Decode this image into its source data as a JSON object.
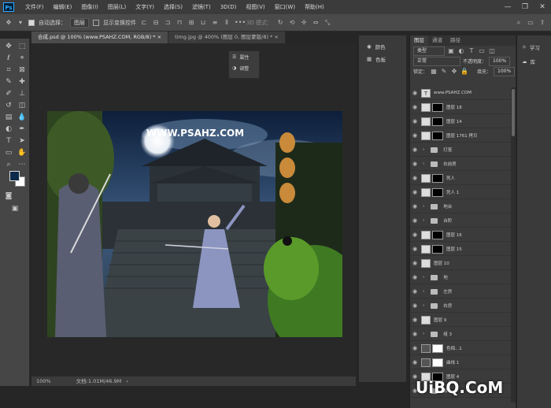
{
  "menu": {
    "items": [
      "文件(F)",
      "编辑(E)",
      "图像(I)",
      "图层(L)",
      "文字(Y)",
      "选择(S)",
      "滤镜(T)",
      "3D(D)",
      "视图(V)",
      "窗口(W)",
      "帮助(H)"
    ],
    "logo": "Ps"
  },
  "options": {
    "auto_select_label": "自动选择：",
    "auto_select_value": "图层",
    "show_transform_label": "显示变换控件",
    "mode3d_label": "3D 模式："
  },
  "tabs": [
    "合成.psd @ 100% (www.PSAHZ.COM, RGB/8) *",
    "timg.jpg @ 400% (图层 0, 图层蒙版/8) *"
  ],
  "canvas": {
    "headline": "WWW.PSAHZ.COM"
  },
  "status": {
    "zoom": "100%",
    "doc": "文档:1.01M/46.9M"
  },
  "props_popup": [
    "属性",
    "调整"
  ],
  "side_panel": [
    "颜色",
    "色板"
  ],
  "right_dock": [
    "学习",
    "库"
  ],
  "layers": {
    "tabs": [
      "图层",
      "通道",
      "路径"
    ],
    "kind_label": "类型",
    "blend": "正常",
    "opacity_label": "不透明度：",
    "opacity": "100%",
    "lock_label": "锁定：",
    "fill_label": "填充：",
    "fill": "100%",
    "list": [
      {
        "name": "www.PSAHZ.COM",
        "kind": "text"
      },
      {
        "name": "图层 18",
        "kind": "mask"
      },
      {
        "name": "图层 14",
        "kind": "mask"
      },
      {
        "name": "图层 1761 拷贝",
        "kind": "mask"
      },
      {
        "name": "灯笼",
        "kind": "group"
      },
      {
        "name": "右前房",
        "kind": "group"
      },
      {
        "name": "死人",
        "kind": "mask"
      },
      {
        "name": "死人 1",
        "kind": "mask"
      },
      {
        "name": "地台",
        "kind": "group"
      },
      {
        "name": "台阶",
        "kind": "group"
      },
      {
        "name": "图层 16",
        "kind": "mask"
      },
      {
        "name": "图层 15",
        "kind": "mask"
      },
      {
        "name": "图层 10",
        "kind": "layer"
      },
      {
        "name": "地",
        "kind": "group"
      },
      {
        "name": "左房",
        "kind": "group"
      },
      {
        "name": "右房",
        "kind": "group"
      },
      {
        "name": "图层 9",
        "kind": "layer"
      },
      {
        "name": "组 3",
        "kind": "group"
      },
      {
        "name": "色相...1",
        "kind": "adjust"
      },
      {
        "name": "曲线 1",
        "kind": "adjust"
      },
      {
        "name": "图层 4",
        "kind": "mask"
      },
      {
        "name": "楼",
        "kind": "group"
      }
    ]
  },
  "watermark": "UiBQ.CoM",
  "colors": {
    "fg": "#0e2a4a",
    "bg": "#ffffff"
  }
}
